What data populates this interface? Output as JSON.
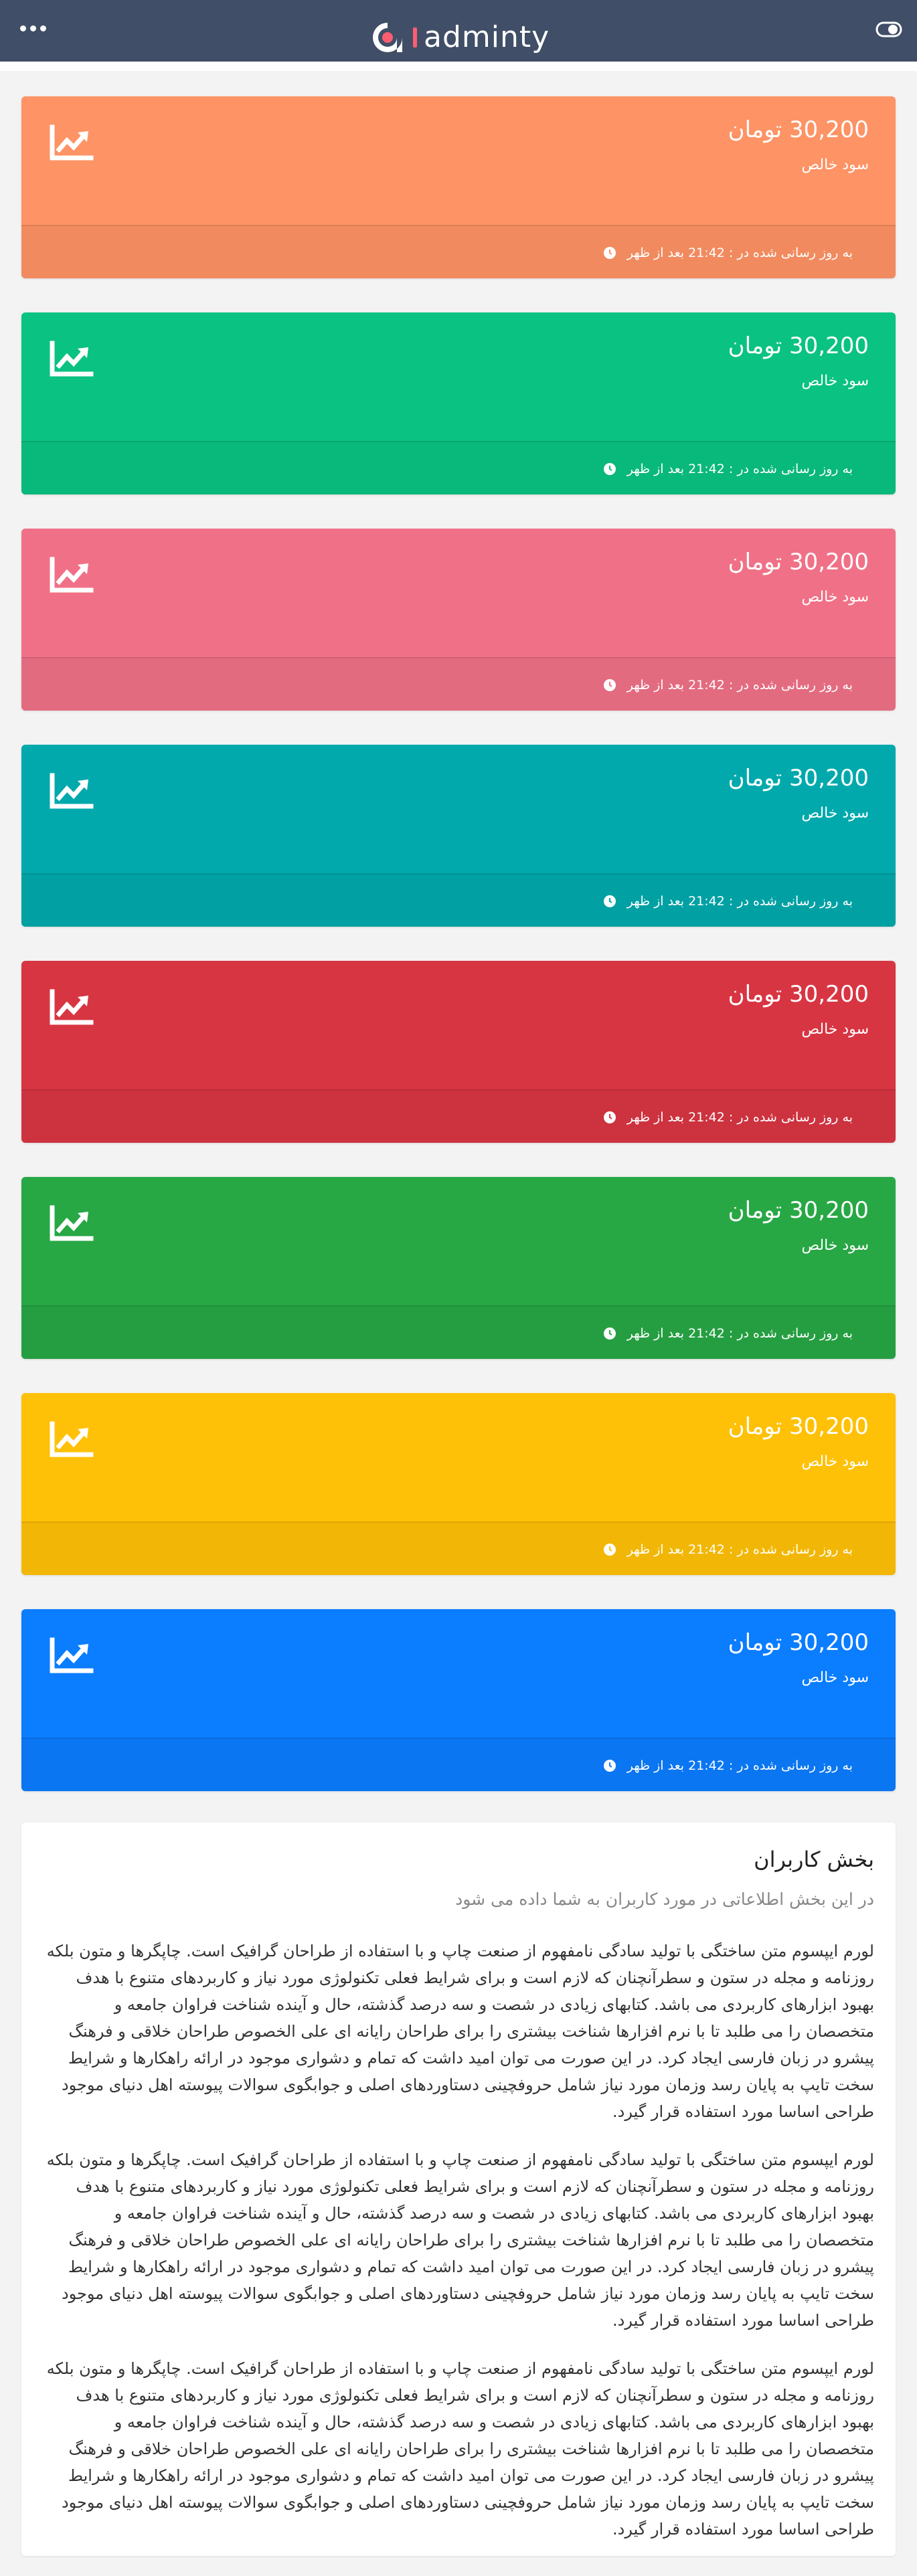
{
  "header": {
    "brand": "adminty",
    "colors": {
      "background": "#404e67",
      "accent": "#fe5d70"
    }
  },
  "cards": [
    {
      "value": "30,200 تومان",
      "label": "سود خالص",
      "update_text": "به روز رسانی شده در : 21:42 بعد از ظهر",
      "icon": "line-chart-icon",
      "color": "#fe9365"
    },
    {
      "value": "30,200 تومان",
      "label": "سود خالص",
      "update_text": "به روز رسانی شده در : 21:42 بعد از ظهر",
      "icon": "line-chart-icon",
      "color": "#0ac282"
    },
    {
      "value": "30,200 تومان",
      "label": "سود خالص",
      "update_text": "به روز رسانی شده در : 21:42 بعد از ظهر",
      "icon": "line-chart-icon",
      "color": "#f07187"
    },
    {
      "value": "30,200 تومان",
      "label": "سود خالص",
      "update_text": "به روز رسانی شده در : 21:42 بعد از ظهر",
      "icon": "line-chart-icon",
      "color": "#01a9ac"
    },
    {
      "value": "30,200 تومان",
      "label": "سود خالص",
      "update_text": "به روز رسانی شده در : 21:42 بعد از ظهر",
      "icon": "line-chart-icon",
      "color": "#d83543"
    },
    {
      "value": "30,200 تومان",
      "label": "سود خالص",
      "update_text": "به روز رسانی شده در : 21:42 بعد از ظهر",
      "icon": "line-chart-icon",
      "color": "#28a745"
    },
    {
      "value": "30,200 تومان",
      "label": "سود خالص",
      "update_text": "به روز رسانی شده در : 21:42 بعد از ظهر",
      "icon": "line-chart-icon",
      "color": "#ffc107"
    },
    {
      "value": "30,200 تومان",
      "label": "سود خالص",
      "update_text": "به روز رسانی شده در : 21:42 بعد از ظهر",
      "icon": "line-chart-icon",
      "color": "#0b7dff"
    }
  ],
  "section": {
    "title": "بخش کاربران",
    "subtitle": "در این بخش اطلاعاتی در مورد کاربران به شما داده می شود",
    "paragraphs": [
      "لورم ایپسوم متن ساختگی با تولید سادگی نامفهوم از صنعت چاپ و با استفاده از طراحان گرافیک است. چاپگرها و متون بلکه روزنامه و مجله در ستون و سطرآنچنان که لازم است و برای شرایط فعلی تکنولوژی مورد نیاز و کاربردهای متنوع با هدف بهبود ابزارهای کاربردی می باشد. کتابهای زیادی در شصت و سه درصد گذشته، حال و آینده شناخت فراوان جامعه و متخصصان را می طلبد تا با نرم افزارها شناخت بیشتری را برای طراحان رایانه ای علی الخصوص طراحان خلاقی و فرهنگ پیشرو در زبان فارسی ایجاد کرد. در این صورت می توان امید داشت که تمام و دشواری موجود در ارائه راهکارها و شرایط سخت تایپ به پایان رسد وزمان مورد نیاز شامل حروفچینی دستاوردهای اصلی و جوابگوی سوالات پیوسته اهل دنیای موجود طراحی اساسا مورد استفاده قرار گیرد.",
      "لورم ایپسوم متن ساختگی با تولید سادگی نامفهوم از صنعت چاپ و با استفاده از طراحان گرافیک است. چاپگرها و متون بلکه روزنامه و مجله در ستون و سطرآنچنان که لازم است و برای شرایط فعلی تکنولوژی مورد نیاز و کاربردهای متنوع با هدف بهبود ابزارهای کاربردی می باشد. کتابهای زیادی در شصت و سه درصد گذشته، حال و آینده شناخت فراوان جامعه و متخصصان را می طلبد تا با نرم افزارها شناخت بیشتری را برای طراحان رایانه ای علی الخصوص طراحان خلاقی و فرهنگ پیشرو در زبان فارسی ایجاد کرد. در این صورت می توان امید داشت که تمام و دشواری موجود در ارائه راهکارها و شرایط سخت تایپ به پایان رسد وزمان مورد نیاز شامل حروفچینی دستاوردهای اصلی و جوابگوی سوالات پیوسته اهل دنیای موجود طراحی اساسا مورد استفاده قرار گیرد.",
      "لورم ایپسوم متن ساختگی با تولید سادگی نامفهوم از صنعت چاپ و با استفاده از طراحان گرافیک است. چاپگرها و متون بلکه روزنامه و مجله در ستون و سطرآنچنان که لازم است و برای شرایط فعلی تکنولوژی مورد نیاز و کاربردهای متنوع با هدف بهبود ابزارهای کاربردی می باشد. کتابهای زیادی در شصت و سه درصد گذشته، حال و آینده شناخت فراوان جامعه و متخصصان را می طلبد تا با نرم افزارها شناخت بیشتری را برای طراحان رایانه ای علی الخصوص طراحان خلاقی و فرهنگ پیشرو در زبان فارسی ایجاد کرد. در این صورت می توان امید داشت که تمام و دشواری موجود در ارائه راهکارها و شرایط سخت تایپ به پایان رسد وزمان مورد نیاز شامل حروفچینی دستاوردهای اصلی و جوابگوی سوالات پیوسته اهل دنیای موجود طراحی اساسا مورد استفاده قرار گیرد."
    ]
  }
}
